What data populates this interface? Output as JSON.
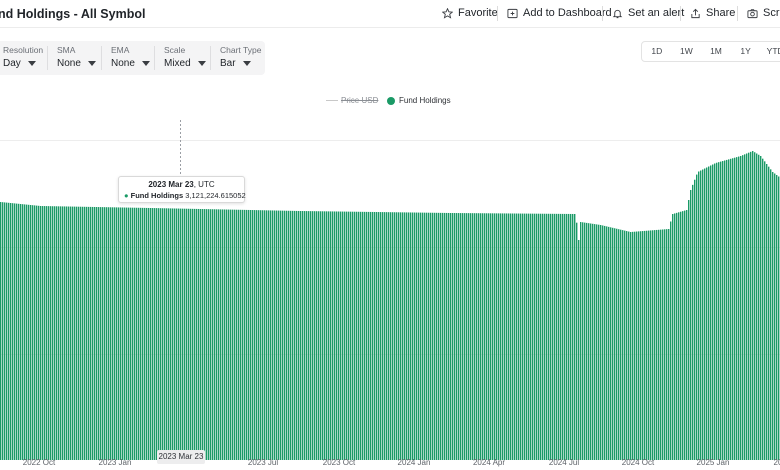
{
  "header": {
    "title": "nd Holdings - All Symbol",
    "actions": {
      "favorite": "Favorite",
      "add_to_dashboard": "Add to Dashboard",
      "set_alert": "Set an alert",
      "share": "Share",
      "screenshot": "Scree"
    }
  },
  "controls": {
    "resolution": {
      "label": "Resolution",
      "value": "Day"
    },
    "sma": {
      "label": "SMA",
      "value": "None"
    },
    "ema": {
      "label": "EMA",
      "value": "None"
    },
    "scale": {
      "label": "Scale",
      "value": "Mixed"
    },
    "chart_type": {
      "label": "Chart Type",
      "value": "Bar"
    }
  },
  "ranges": [
    "1D",
    "1W",
    "1M",
    "1Y",
    "YTD"
  ],
  "legend": {
    "price": "Price USD",
    "fund": "Fund Holdings"
  },
  "tooltip": {
    "date": "2023 Mar 23",
    "tz": ", UTC",
    "series": "Fund Holdings",
    "value": "3,121,224.615052"
  },
  "crosshair_label": "2023 Mar 23",
  "chart_data": {
    "type": "bar",
    "series": [
      {
        "name": "Fund Holdings",
        "color": "#1a9a66"
      }
    ],
    "x_tick_labels": [
      "2022 Oct",
      "2023 Jan",
      "2023 Jul",
      "2023 Oct",
      "2024 Jan",
      "2024 Apr",
      "2024 Jul",
      "2024 Oct",
      "2025 Jan",
      "20"
    ],
    "grid": true,
    "legend_position": "top-center"
  }
}
